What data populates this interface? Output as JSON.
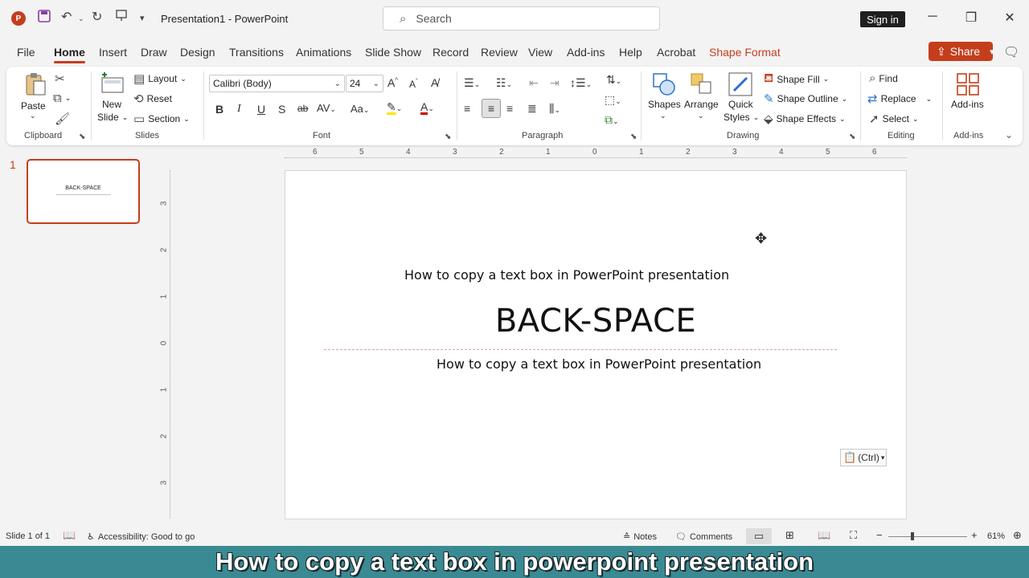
{
  "titlebar": {
    "logo_letter": "P",
    "doc_title": "Presentation1  -  PowerPoint",
    "search_placeholder": "Search",
    "signin_label": "Sign in"
  },
  "tabs": [
    {
      "label": "File"
    },
    {
      "label": "Home"
    },
    {
      "label": "Insert"
    },
    {
      "label": "Draw"
    },
    {
      "label": "Design"
    },
    {
      "label": "Transitions"
    },
    {
      "label": "Animations"
    },
    {
      "label": "Slide Show"
    },
    {
      "label": "Record"
    },
    {
      "label": "Review"
    },
    {
      "label": "View"
    },
    {
      "label": "Add-ins"
    },
    {
      "label": "Help"
    },
    {
      "label": "Acrobat"
    },
    {
      "label": "Shape Format"
    }
  ],
  "share_label": "Share",
  "ribbon": {
    "clipboard": {
      "label": "Clipboard",
      "paste": "Paste"
    },
    "slides": {
      "label": "Slides",
      "new_slide_1": "New",
      "new_slide_2": "Slide",
      "layout": "Layout",
      "reset": "Reset",
      "section": "Section"
    },
    "font": {
      "label": "Font",
      "font_name": "Calibri (Body)",
      "font_size": "24"
    },
    "paragraph": {
      "label": "Paragraph"
    },
    "drawing": {
      "label": "Drawing",
      "shapes": "Shapes",
      "arrange": "Arrange",
      "quick_styles_1": "Quick",
      "quick_styles_2": "Styles",
      "shape_fill": "Shape Fill",
      "shape_outline": "Shape Outline",
      "shape_effects": "Shape Effects"
    },
    "editing": {
      "label": "Editing",
      "find": "Find",
      "replace": "Replace",
      "select": "Select"
    },
    "addins": {
      "label": "Add-ins",
      "button": "Add-ins"
    }
  },
  "thumbnail": {
    "number": "1",
    "title": "BACK-SPACE"
  },
  "ruler": {
    "h_ticks": [
      "6",
      "5",
      "4",
      "3",
      "2",
      "1",
      "0",
      "1",
      "2",
      "3",
      "4",
      "5",
      "6"
    ],
    "v_ticks": [
      "3",
      "2",
      "1",
      "0",
      "1",
      "2",
      "3"
    ]
  },
  "slide": {
    "copied_text": "How to copy a text box in PowerPoint presentation",
    "title": "BACK-SPACE",
    "subtitle": "How to copy a text box in PowerPoint presentation",
    "paste_options": "(Ctrl)"
  },
  "statusbar": {
    "slide_count": "Slide 1 of 1",
    "accessibility": "Accessibility: Good to go",
    "notes": "Notes",
    "comments": "Comments",
    "zoom": "61%",
    "zoom_level": 0.61
  },
  "caption": "How to copy a text box in powerpoint presentation",
  "colors": {
    "accent": "#c43e1c",
    "banner": "#3a8a93"
  }
}
